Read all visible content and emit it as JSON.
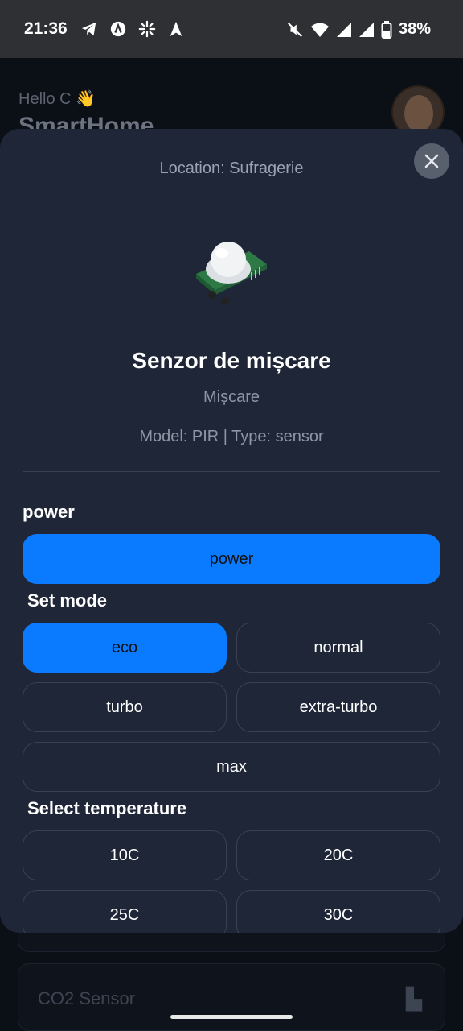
{
  "status_bar": {
    "time": "21:36",
    "battery": "38%",
    "left_icons": [
      "telegram-icon",
      "app-icon",
      "sparkle-icon",
      "navigation-icon"
    ],
    "right_icons": [
      "mute-icon",
      "wifi-icon",
      "signal-icon",
      "signal-icon",
      "battery-icon"
    ]
  },
  "background": {
    "greeting": "Hello C 👋",
    "app_title": "SmartHome",
    "card_label": "CO2 Sensor"
  },
  "modal": {
    "location": "Location: Sufragerie",
    "device_name": "Senzor de mișcare",
    "device_category": "Mișcare",
    "device_meta": "Model: PIR | Type: sensor",
    "power_section": {
      "title": "power",
      "button": "power",
      "active": true
    },
    "mode_section": {
      "title": "Set mode",
      "options": [
        "eco",
        "normal",
        "turbo",
        "extra-turbo",
        "max"
      ],
      "selected": "eco"
    },
    "temperature_section": {
      "title": "Select temperature",
      "options": [
        "10C",
        "20C",
        "25C",
        "30C"
      ]
    }
  },
  "colors": {
    "accent": "#0a7bff",
    "modal_bg": "#1f2637",
    "page_bg": "#0b0f16"
  }
}
